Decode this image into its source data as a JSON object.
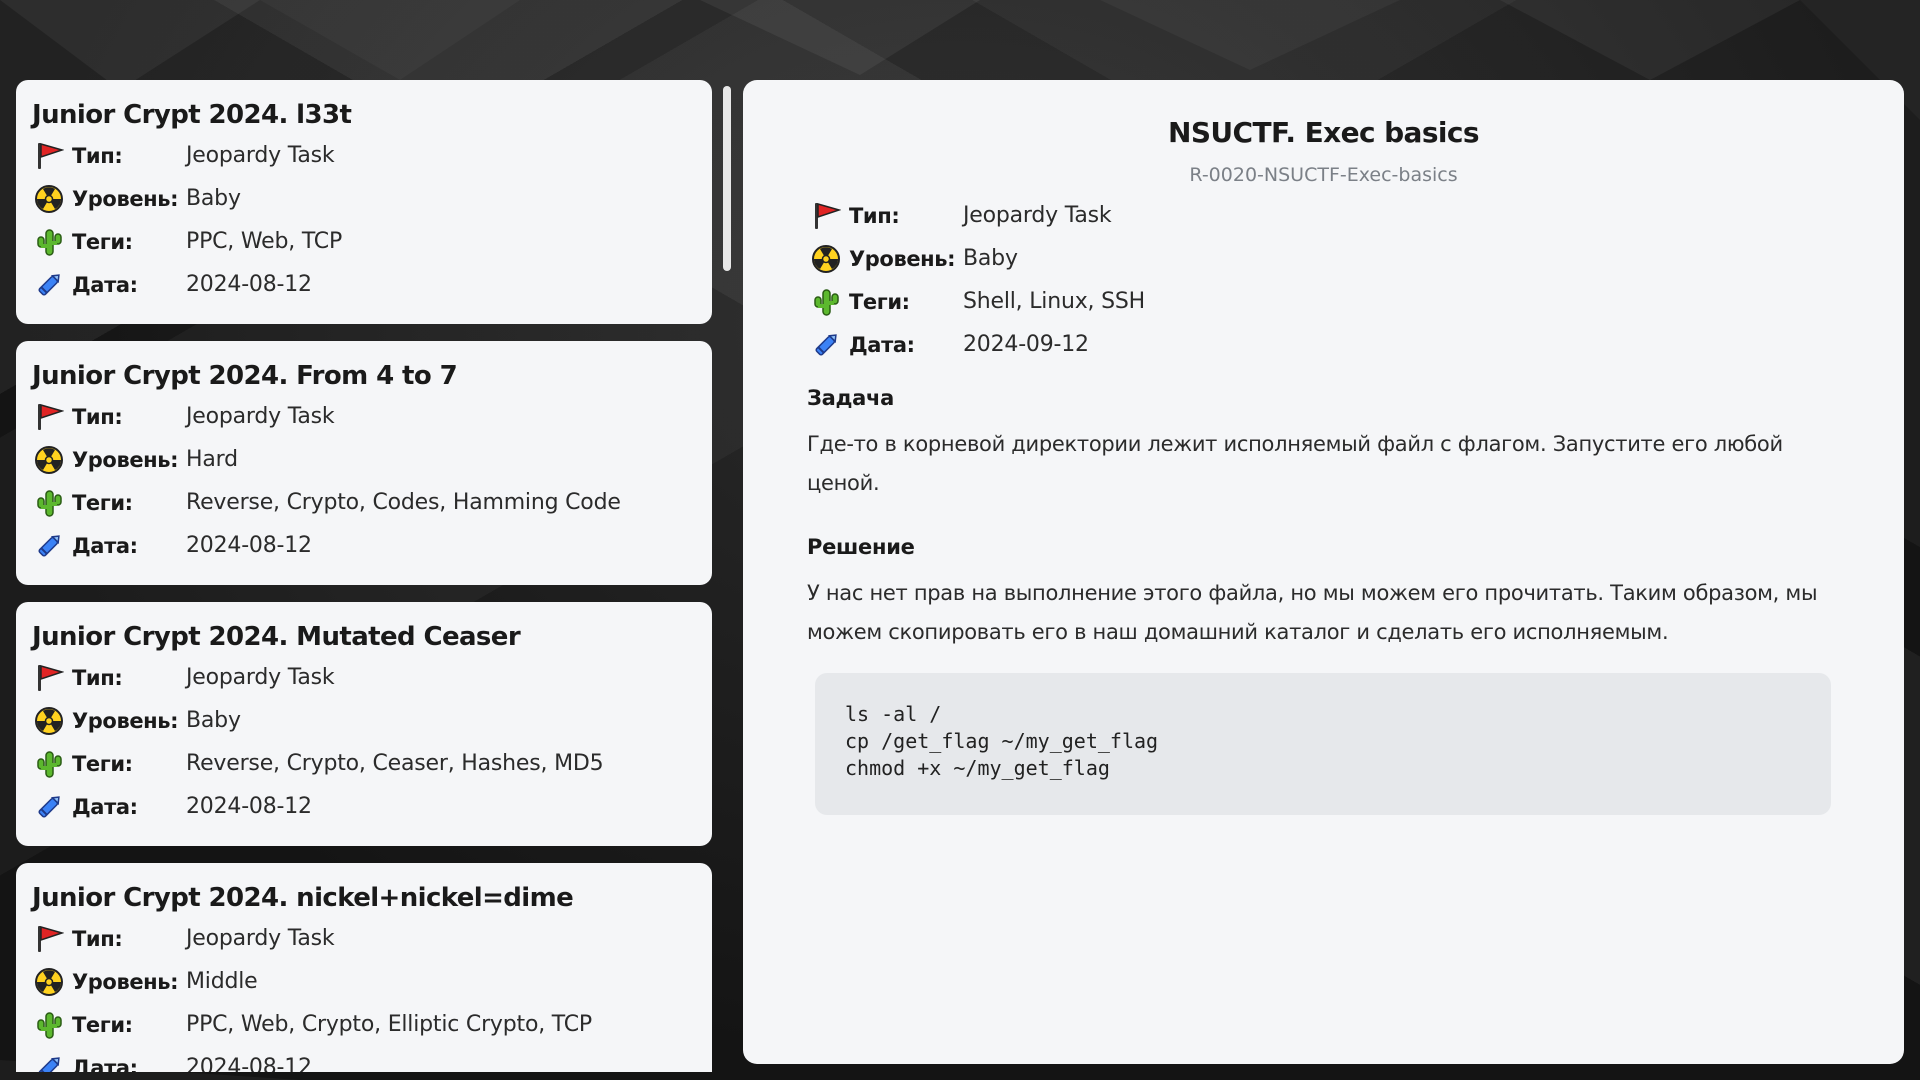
{
  "labels": {
    "type": "Тип:",
    "level": "Уровень:",
    "tags": "Теги:",
    "date": "Дата:"
  },
  "icons": {
    "type": "red-flag-icon",
    "level": "radioactive-icon",
    "tags": "cactus-icon",
    "date": "crayon-icon"
  },
  "colors": {
    "card_bg": "#f5f6f8",
    "page_bg": "#141414",
    "code_bg": "#e6e8eb",
    "muted_text": "#7b8087"
  },
  "tasks": [
    {
      "title": "Junior Crypt 2024. l33t",
      "type": "Jeopardy Task",
      "level": "Baby",
      "tags": "PPC, Web, TCP",
      "date": "2024-08-12"
    },
    {
      "title": "Junior Crypt 2024. From 4 to 7",
      "type": "Jeopardy Task",
      "level": "Hard",
      "tags": "Reverse, Crypto, Codes, Hamming Code",
      "date": "2024-08-12"
    },
    {
      "title": "Junior Crypt 2024. Mutated Ceaser",
      "type": "Jeopardy Task",
      "level": "Baby",
      "tags": "Reverse, Crypto, Ceaser, Hashes, MD5",
      "date": "2024-08-12"
    },
    {
      "title": "Junior Crypt 2024. nickel+nickel=dime",
      "type": "Jeopardy Task",
      "level": "Middle",
      "tags": "PPC, Web, Crypto, Elliptic Crypto, TCP",
      "date": "2024-08-12"
    }
  ],
  "detail": {
    "title": "NSUCTF. Exec basics",
    "code": "R-0020-NSUCTF-Exec-basics",
    "type": "Jeopardy Task",
    "level": "Baby",
    "tags": "Shell, Linux, SSH",
    "date": "2024-09-12",
    "task_heading": "Задача",
    "task_text": "Где-то в корневой директории лежит исполняемый файл с флагом. Запустите его любой ценой.",
    "solution_heading": "Решение",
    "solution_text": "У нас нет прав на выполнение этого файла, но мы можем его прочитать. Таким образом, мы можем скопировать его в наш домашний каталог и сделать его исполняемым.",
    "code_lines": [
      "ls -al /",
      "cp /get_flag ~/my_get_flag",
      "chmod +x ~/my_get_flag"
    ]
  }
}
